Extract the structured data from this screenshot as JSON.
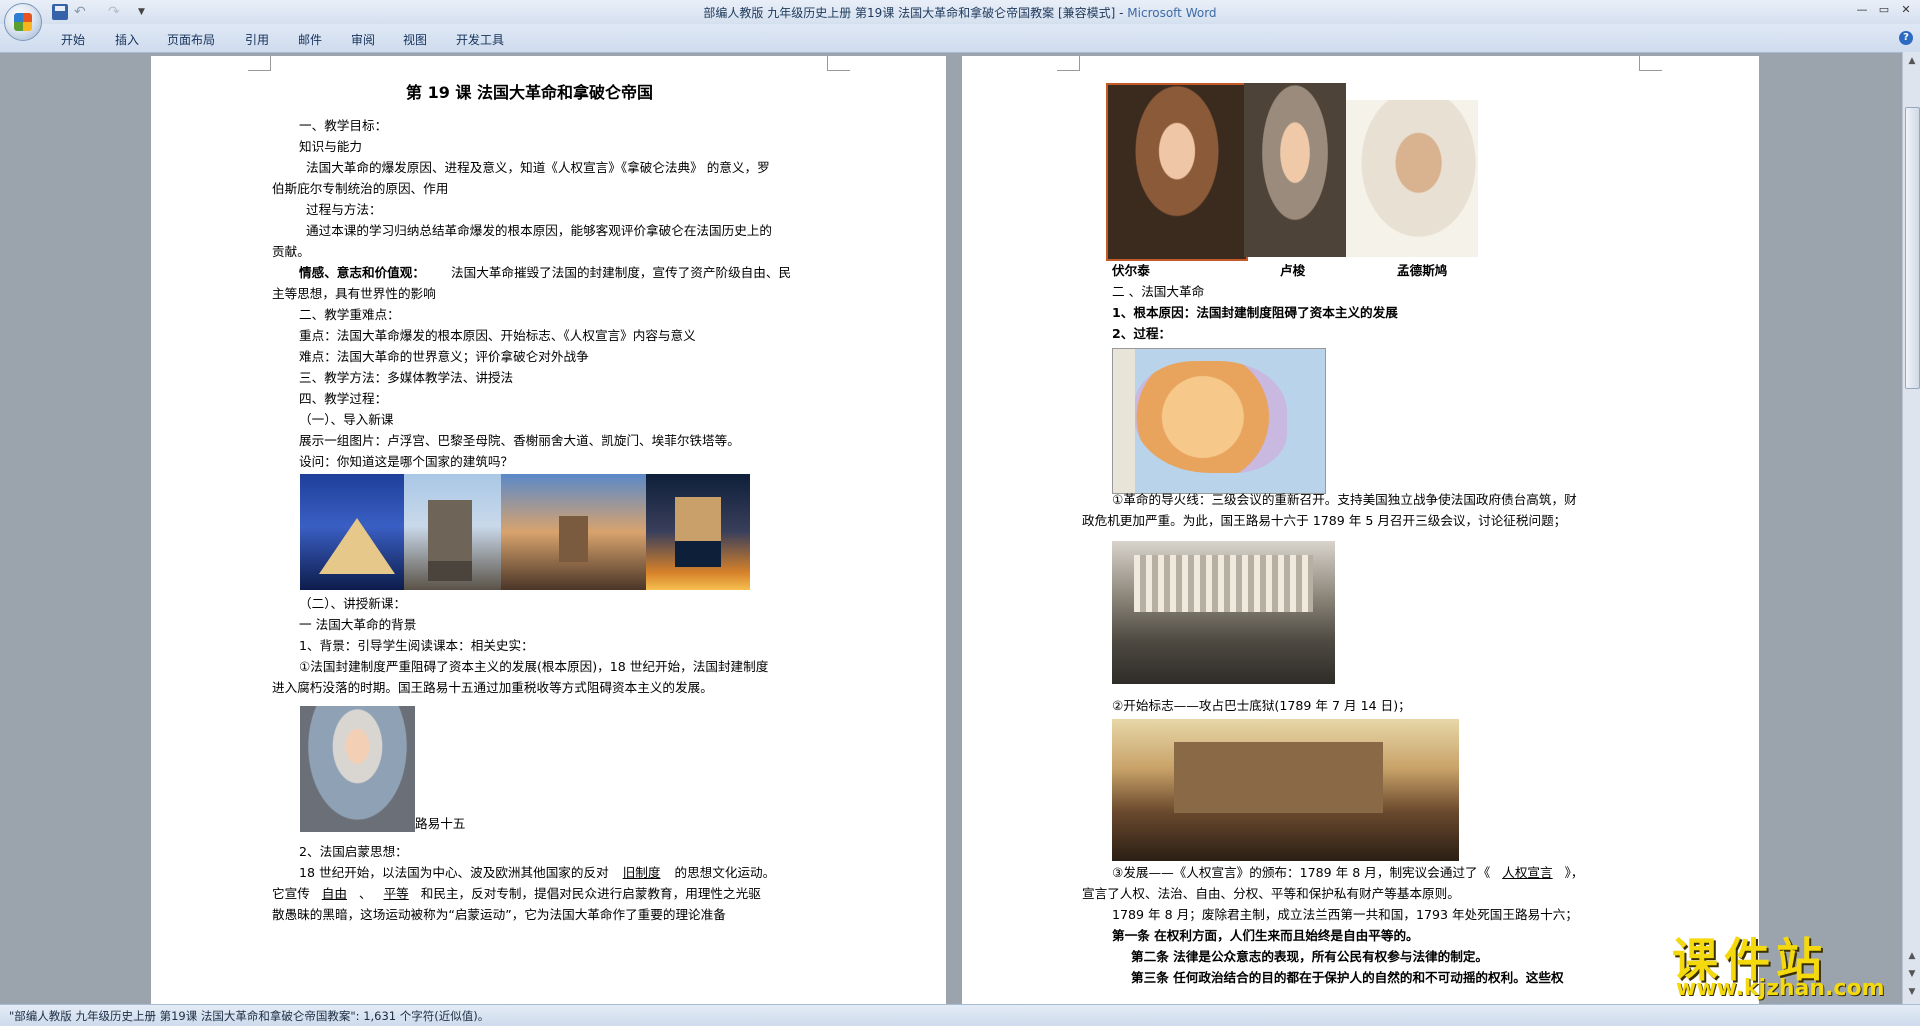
{
  "window": {
    "title": "部编人教版  九年级历史上册 第19课  法国大革命和拿破仑帝国教案 [兼容模式] - ",
    "app_name": "Microsoft Word"
  },
  "quick_access": {
    "undo": "↶",
    "redo": "↷",
    "more": "▼"
  },
  "window_buttons": {
    "minimize": "—",
    "maximize": "▭",
    "close": "✕"
  },
  "ribbon": {
    "tabs": [
      "开始",
      "插入",
      "页面布局",
      "引用",
      "邮件",
      "审阅",
      "视图",
      "开发工具"
    ],
    "help": "?"
  },
  "left_page": {
    "title": "第  19 课    法国大革命和拿破仑帝国",
    "lines": [
      "一、教学目标：",
      "知识与能力",
      "法国大革命的爆发原因、进程及意义，知道《人权宣言》《拿破仑法典》 的意义，罗",
      "伯斯庇尔专制统治的原因、作用",
      "过程与方法：",
      "通过本课的学习归纳总结革命爆发的根本原因，能够客观评价拿破仑在法国历史上的",
      "贡献。",
      "情感、意志和价值观：",
      "法国大革命摧毁了法国的封建制度，宣传了资产阶级自由、民",
      "主等思想，具有世界性的影响",
      "二、教学重难点：",
      "重点：法国大革命爆发的根本原因、开始标志、《人权宣言》内容与意义",
      "难点：法国大革命的世界意义；评价拿破仑对外战争",
      "三、教学方法：多媒体教学法、讲授法",
      "四、教学过程：",
      "（一）、导入新课",
      "展示一组图片：卢浮宫、巴黎圣母院、香榭丽舍大道、凯旋门、埃菲尔铁塔等。",
      "设问：你知道这是哪个国家的建筑吗？",
      "（二）、讲授新课：",
      "一    法国大革命的背景",
      "1、背景：引导学生阅读课本：相关史实：",
      "①法国封建制度严重阻碍了资本主义的发展(根本原因)，18 世纪开始，法国封建制度",
      "进入腐朽没落的时期。国王路易十五通过加重税收等方式阻碍资本主义的发展。",
      "路易十五",
      "2、法国启蒙思想：",
      "18  世纪开始，以法国为中心、波及欧洲其他国家的反对",
      "旧制度",
      "的思想文化运动。",
      "它宣传",
      "自由",
      "、",
      "平等",
      "和民主，反对专制，提倡对民众进行启蒙教育，用理性之光驱",
      "散愚昧的黑暗，这场运动被称为“启蒙运动”，它为法国大革命作了重要的理论准备"
    ]
  },
  "right_page": {
    "portrait_names": [
      "伏尔泰",
      "卢梭",
      "孟德斯鸠"
    ],
    "lines": [
      "二    、法国大革命",
      "1、根本原因：法国封建制度阻碍了资本主义的发展",
      "2、过程：",
      "①革命的导火线：三级会议的重新召开。支持美国独立战争使法国政府债台高筑，财",
      "政危机更加严重。为此，国王路易十六于 1789 年 5 月召开三级会议，讨论征税问题；",
      "②开始标志——攻占巴士底狱(1789 年 7 月 14 日)；",
      "③发展——《人权宣言》的颁布：1789 年 8 月，制宪议会通过了《",
      "人权宣言",
      "》，",
      "宣言了人权、法治、自由、分权、平等和保护私有财产等基本原则。",
      "1789 年 8 月；废除君主制，成立法兰西第一共和国，1793 年处死国王路易十六；",
      "第一条     在权利方面，人们生来而且始终是自由平等的。",
      "第二条     法律是公众意志的表现，所有公民有权参与法律的制定。",
      "第三条     任何政治结合的目的都在于保护人的自然的和不可动摇的权利。这些权"
    ]
  },
  "status_bar": {
    "text": "\"部编人教版  九年级历史上册 第19课  法国大革命和拿破仑帝国教案\": 1,631 个字符(近似值)。"
  },
  "watermark": {
    "main": "课件站",
    "sub": "www.kjzhan.com",
    "color": "#f4d90f"
  },
  "colors": {
    "title_app": "#3d6aa7",
    "ribbon": "#dfe8f5",
    "workspace": "#9ba3ad"
  }
}
